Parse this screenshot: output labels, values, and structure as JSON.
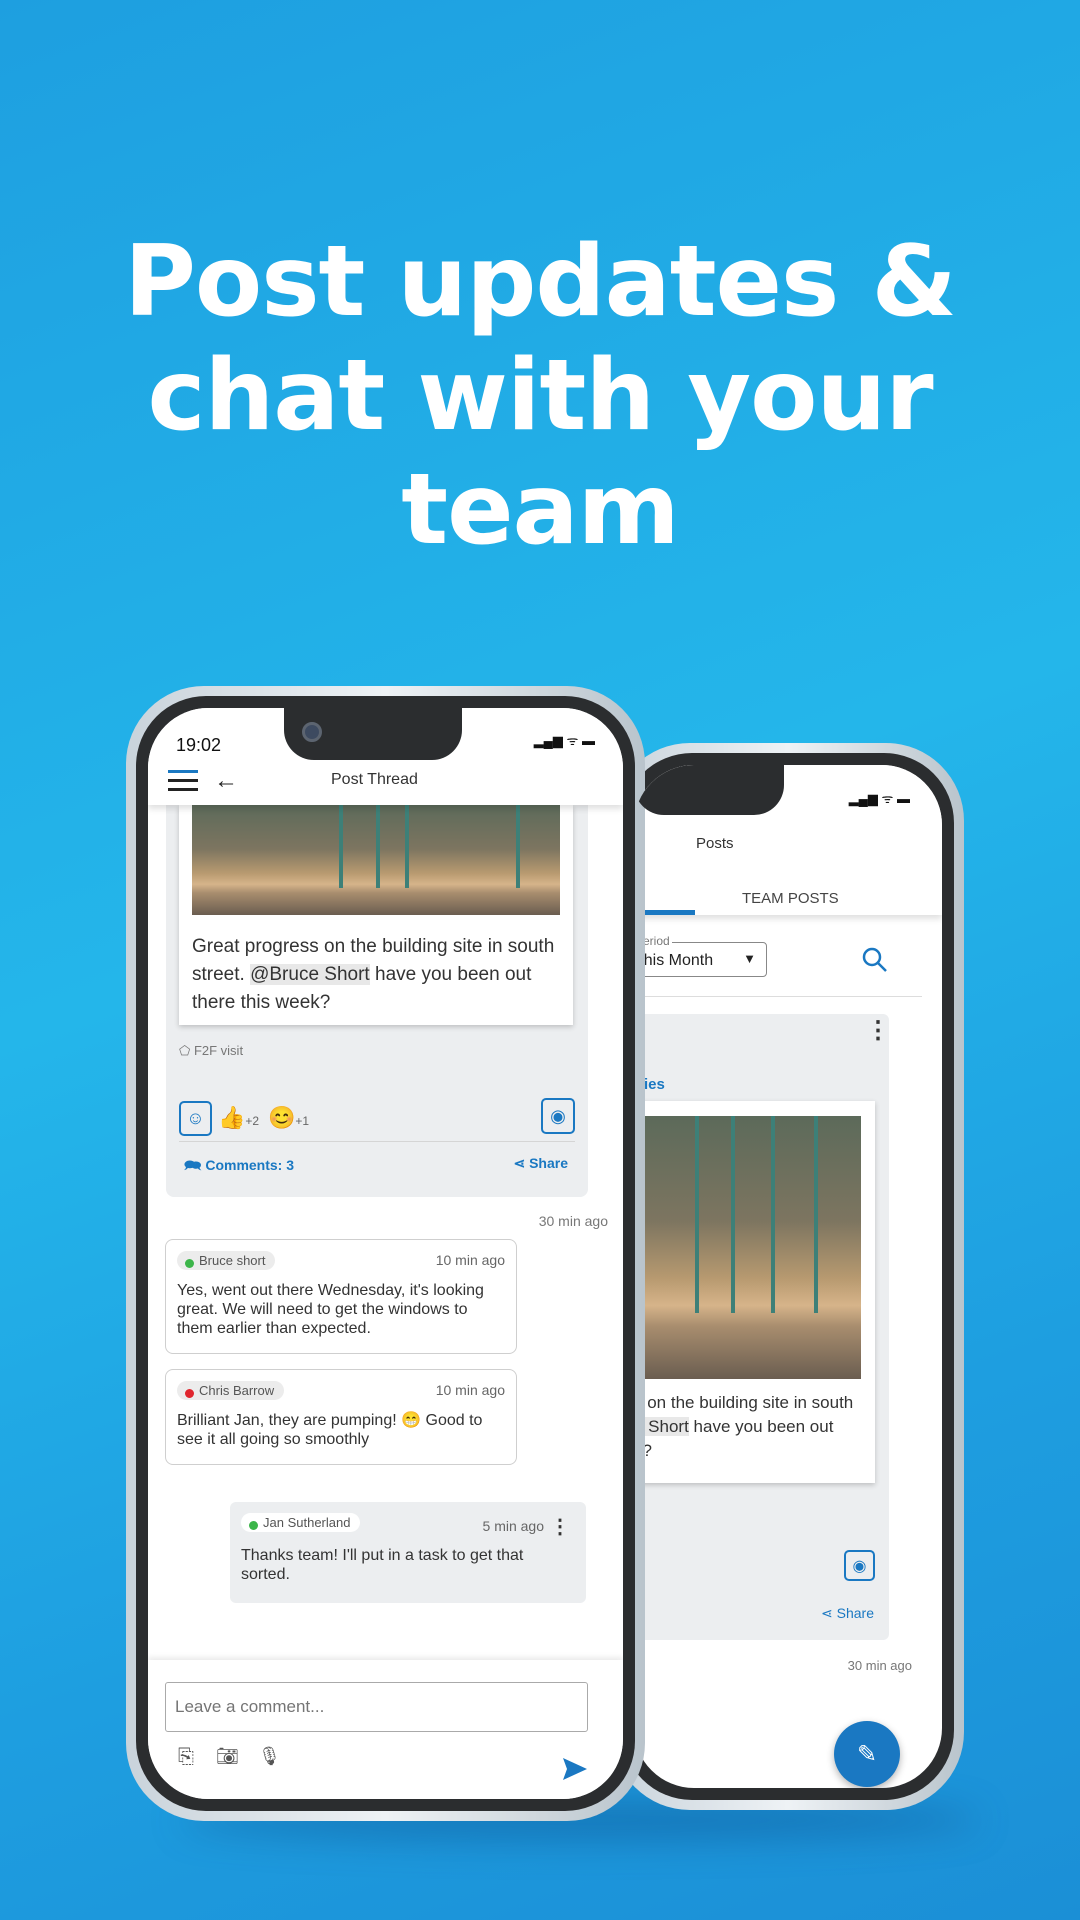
{
  "headline": {
    "line1": "Post updates &",
    "line2": "chat with your team"
  },
  "colors": {
    "accent": "#1a78c2",
    "online": "#3cb54a",
    "busy": "#e0262e"
  },
  "front_phone": {
    "status_time": "19:02",
    "header": {
      "title": "Post Thread",
      "menu_icon": "hamburger-icon",
      "back_icon": "arrow-left-icon"
    },
    "post": {
      "text_before": "Great progress on the building site in south street.",
      "mention": "@Bruce Short",
      "text_after": "have you been out there this week?",
      "tag": "F2F visit",
      "reactions": [
        {
          "emoji": "👍",
          "count": "+2"
        },
        {
          "emoji": "😊",
          "count": "+1"
        }
      ],
      "comments_label": "Comments: 3",
      "share_label": "Share",
      "time": "30 min ago"
    },
    "comments": [
      {
        "author": "Bruce short",
        "status": "online",
        "time": "10 min ago",
        "text": "Yes, went out there Wednesday, it's looking great. We will need to get the windows to them earlier than expected."
      },
      {
        "author": "Chris Barrow",
        "status": "busy",
        "time": "10 min ago",
        "text_before": "Brilliant Jan, they are pumping!",
        "emoji": "😁",
        "text_after": "Good to see it all going so smoothly"
      },
      {
        "author": "Jan Sutherland",
        "status": "online",
        "time": "5 min ago",
        "text": "Thanks team! I'll put in a task to get that sorted."
      }
    ],
    "composer": {
      "placeholder": "Leave a comment..."
    }
  },
  "back_phone": {
    "header": {
      "title": "Posts"
    },
    "tabs": [
      {
        "label": "TEAM POSTS",
        "active": false
      }
    ],
    "period": {
      "label": "Period",
      "value": "This Month"
    },
    "post": {
      "link_fragment": "ies",
      "line1": "s on the building site in south",
      "mention_fragment": "e Short",
      "line2_after": "have you been out",
      "line3": "k?",
      "share_label": "Share",
      "time": "30 min ago"
    }
  }
}
